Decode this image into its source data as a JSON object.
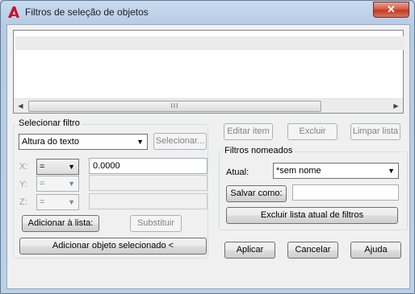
{
  "window": {
    "title": "Filtros de seleção de objetos",
    "close_glyph": "✕"
  },
  "filter_list": {
    "items": [
      ""
    ],
    "scroll_grip": "III"
  },
  "select_filter": {
    "group_label": "Selecionar filtro",
    "type_value": "Altura do texto",
    "select_button": "Selecionar...",
    "x_label": "X:",
    "y_label": "Y:",
    "z_label": "Z:",
    "x_operator": "=",
    "y_operator": "=",
    "z_operator": "=",
    "x_value": "0.0000",
    "add_to_list_button": "Adicionar à lista:",
    "substitute_button": "Substituir",
    "add_selected_button": "Adicionar objeto selecionado <"
  },
  "list_actions": {
    "edit_button": "Editar item",
    "delete_button": "Excluir",
    "clear_button": "Limpar lista"
  },
  "named_filters": {
    "group_label": "Filtros nomeados",
    "current_label": "Atual:",
    "current_value": "*sem nome",
    "save_as_button": "Salvar como:",
    "save_as_value": "",
    "delete_current_button": "Excluir lista atual de filtros"
  },
  "footer": {
    "apply_button": "Aplicar",
    "cancel_button": "Cancelar",
    "help_button": "Ajuda"
  }
}
